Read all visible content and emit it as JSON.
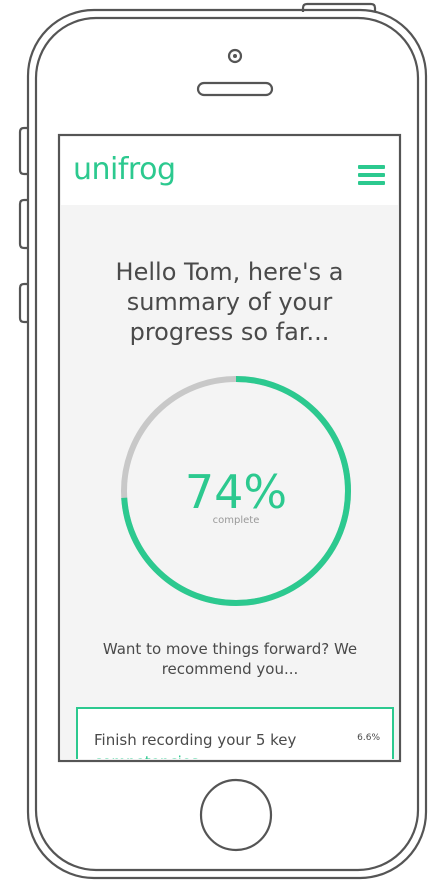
{
  "app": {
    "logo": "unifrog",
    "menu_icon": "hamburger-menu-icon"
  },
  "greeting": "Hello Tom, here's a summary of your progress so far...",
  "progress": {
    "percent": 74,
    "percent_label": "74%",
    "caption": "complete",
    "fill_color": "#2cc98f",
    "track_color": "#c8c8c8"
  },
  "recommendation": {
    "intro": "Want to move things forward? We recommend you...",
    "task": {
      "title_start": "Finish recording your 5 key",
      "title_highlight": "competencies",
      "percent": "6.6%"
    }
  },
  "colors": {
    "accent": "#2cc98f",
    "text": "#4a4a4a"
  }
}
